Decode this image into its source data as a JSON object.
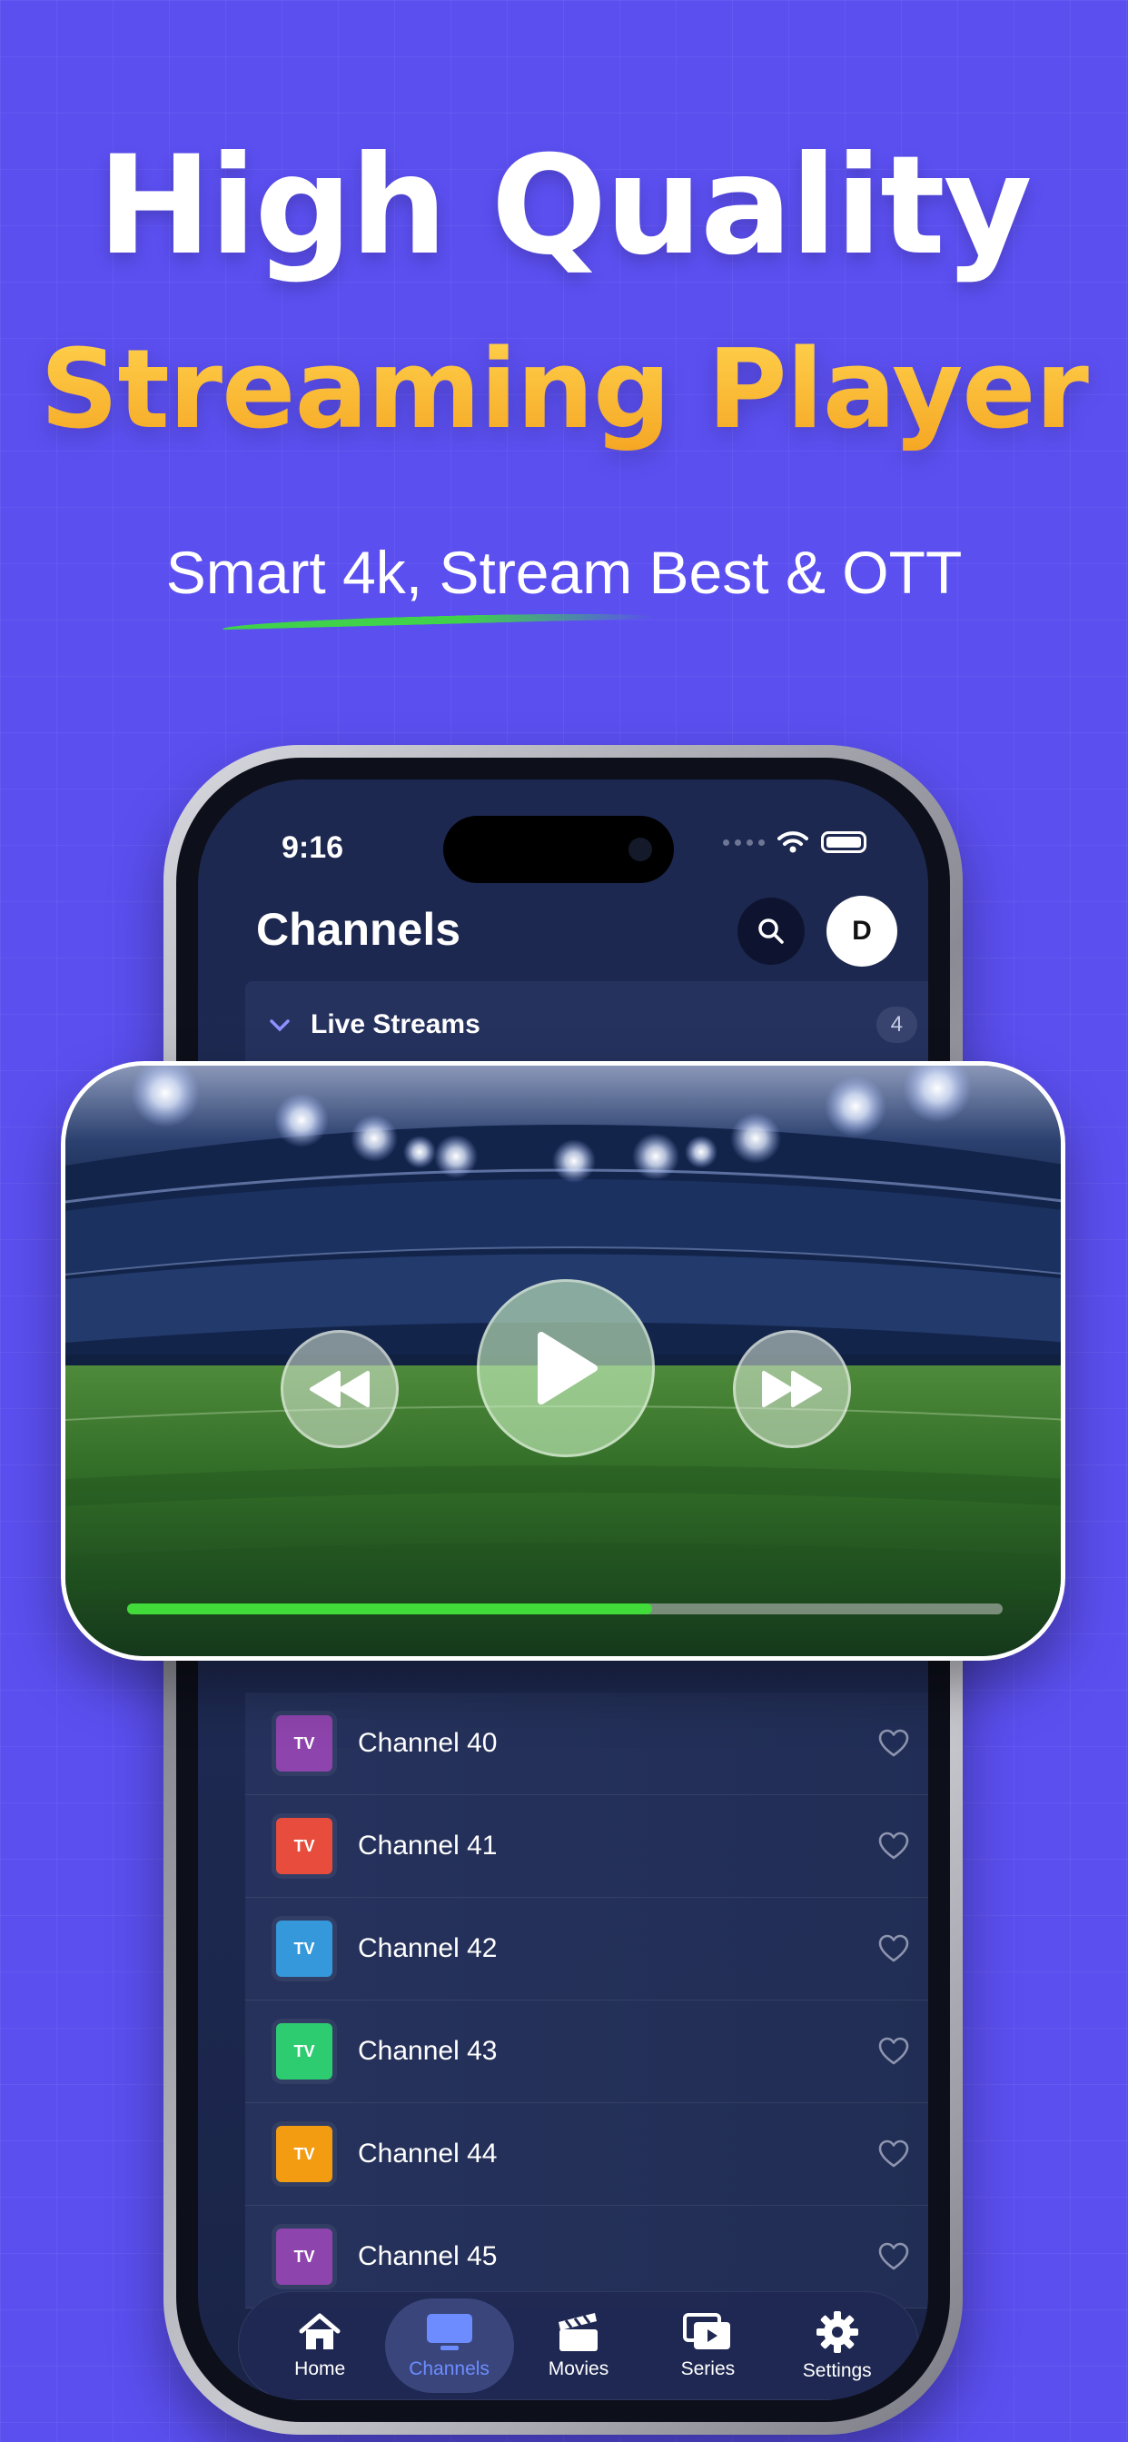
{
  "hero": {
    "title_line1": "High Quality",
    "title_line2": "Streaming Player",
    "tagline": "Smart 4k, Stream Best & OTT"
  },
  "status_bar": {
    "time": "9:16"
  },
  "header": {
    "title": "Channels",
    "search_icon": "search-icon",
    "avatar_initial": "D"
  },
  "section": {
    "title": "Live Streams",
    "count": "4"
  },
  "player": {
    "progress": 0.6
  },
  "channels": [
    {
      "name": "Channel 40",
      "logo": "TV",
      "color": "#8e44ad"
    },
    {
      "name": "Channel 41",
      "logo": "TV",
      "color": "#e74c3c"
    },
    {
      "name": "Channel 42",
      "logo": "TV",
      "color": "#3498db"
    },
    {
      "name": "Channel 43",
      "logo": "TV",
      "color": "#2ecc71"
    },
    {
      "name": "Channel 44",
      "logo": "TV",
      "color": "#f39c12"
    },
    {
      "name": "Channel 45",
      "logo": "TV",
      "color": "#8e44ad"
    }
  ],
  "tabs": [
    {
      "label": "Home",
      "icon": "home-icon"
    },
    {
      "label": "Channels",
      "icon": "tv-icon"
    },
    {
      "label": "Movies",
      "icon": "clapperboard-icon"
    },
    {
      "label": "Series",
      "icon": "series-icon"
    },
    {
      "label": "Settings",
      "icon": "gear-icon"
    }
  ],
  "colors": {
    "background": "#5b4ff0",
    "accent_yellow": "#f8b92a",
    "progress_green": "#41dc3a",
    "active_tab": "#6d8cff"
  }
}
